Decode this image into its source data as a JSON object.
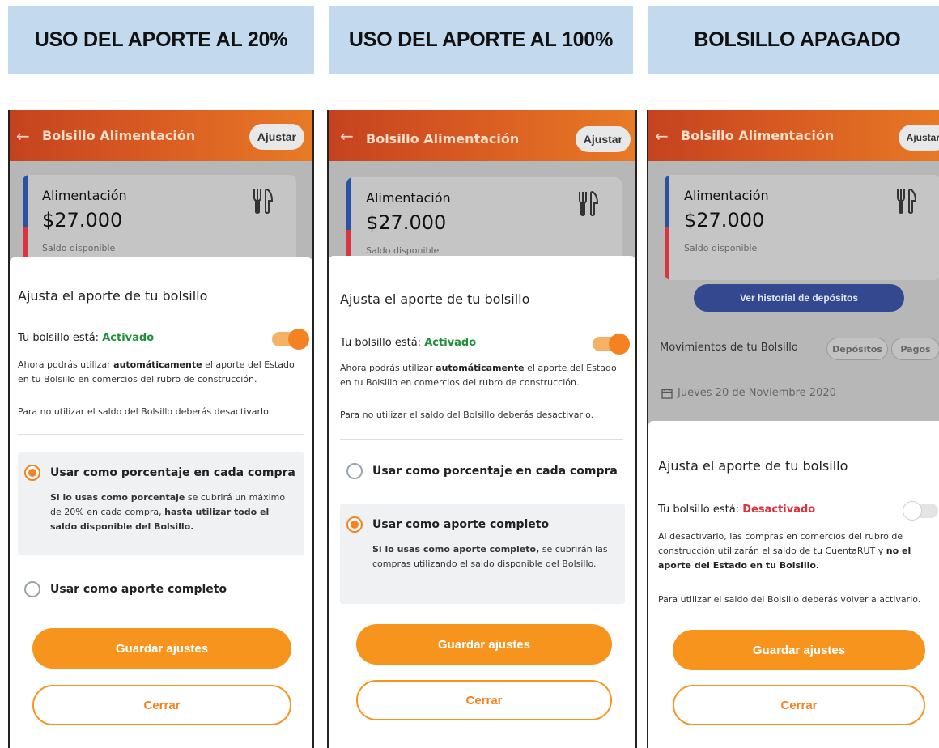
{
  "banners": [
    "USO DEL APORTE AL 20%",
    "USO DEL APORTE AL 100%",
    "BOLSILLO APAGADO"
  ],
  "appbar": {
    "back_icon": "arrow-left-icon",
    "title": "Bolsillo Alimentación",
    "adjust_label": "Ajustar"
  },
  "card": {
    "name": "Alimentación",
    "amount": "$27.000",
    "subtitle": "Saldo disponible",
    "icon": "fork-knife-icon"
  },
  "sheet": {
    "title": "Ajusta el aporte de tu bolsillo",
    "status_prefix": "Tu bolsillo está:",
    "status_on": "Activado",
    "status_off": "Desactivado",
    "on_para_1a": "Ahora podrás utilizar ",
    "on_para_1b": "automáticamente",
    "on_para_1c": " el aporte del Estado en tu Bolsillo en comercios del rubro de construcción.",
    "on_para_2": "Para no utilizar el saldo del Bolsillo deberás desactivarlo.",
    "off_para_1a": "Al desactivarlo, las compras en comercios del rubro de construcción utilizarán el saldo de tu CuentaRUT y ",
    "off_para_1b": "no el aporte del Estado en tu Bolsillo.",
    "off_para_2": "Para utilizar el saldo del Bolsillo deberás volver a activarlo.",
    "option_percent": "Usar como porcentaje en cada compra",
    "option_full": "Usar como aporte completo",
    "percent_desc_a": "Si lo usas como porcentaje",
    "percent_desc_b": " se cubrirá un máximo de 20% en cada compra, ",
    "percent_desc_c": "hasta utilizar todo el saldo disponible del Bolsillo.",
    "full_desc_a": "Si lo usas como aporte completo,",
    "full_desc_b": " se cubrirán las compras utilizando el saldo disponible del Bolsillo.",
    "save_label": "Guardar ajustes",
    "close_label": "Cerrar"
  },
  "history_label": "Ver historial de depósitos",
  "movements": {
    "title": "Movimientos de tu Bolsillo",
    "chip_deposits": "Depósitos",
    "chip_payments": "Pagos",
    "date_icon": "calendar-icon",
    "date": "Jueves 20 de Noviembre 2020"
  },
  "states": [
    {
      "toggle": "on",
      "selected_option": "percent"
    },
    {
      "toggle": "on",
      "selected_option": "full"
    },
    {
      "toggle": "off",
      "selected_option": null
    }
  ],
  "colors": {
    "accent": "#f58220",
    "status_on": "#1f8f3a",
    "status_off": "#e0303a",
    "banner_bg": "#c3d9ee",
    "history_btn": "#34488f"
  }
}
